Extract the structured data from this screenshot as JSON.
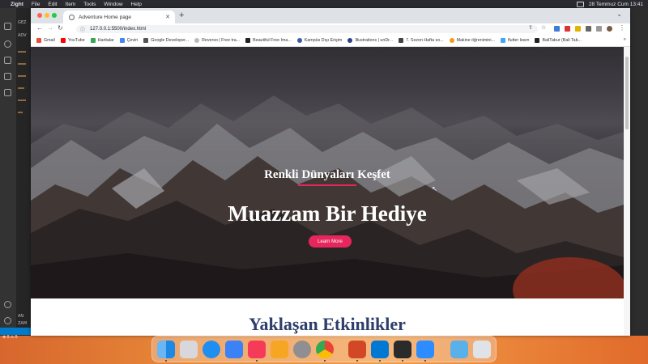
{
  "menubar": {
    "app": "Zight",
    "items": [
      "File",
      "Edit",
      "Item",
      "Tools",
      "Window",
      "Help"
    ],
    "datetime": "28 Temmuz Cum 13:41"
  },
  "browser": {
    "tab_title": "Adventure Home page",
    "url": "127.0.0.1:5500/index.html",
    "bookmarks": [
      "Gmail",
      "YouTube",
      "Haritalar",
      "Çeviri",
      "Google Developer...",
      "Reverso | Free tra...",
      "Beautiful Free Ima...",
      "Kampüs Dışı Erişim",
      "Illustrations | unDr...",
      "7. Sezon Hafta so...",
      "Makine öğrenimini...",
      "flutter learn",
      "BaliTabur (Bali Tab..."
    ]
  },
  "hero": {
    "subtitle": "Renkli Dünyaları Keşfet",
    "title": "Muazzam Bir Hediye",
    "button": "Learn More"
  },
  "section": {
    "title": "Yaklaşan Etkinlikler"
  },
  "vscode": {
    "labels": [
      "GEZ",
      "ADV",
      "AN",
      "ZAM"
    ],
    "status": "⊗ 0 ⚠ 0"
  },
  "colors": {
    "accent": "#e8265e",
    "section_title": "#2d3e6b"
  },
  "icons": [
    "apple-icon",
    "back-icon",
    "forward-icon",
    "reload-icon",
    "lock-icon",
    "share-icon",
    "star-icon",
    "extension-icon",
    "profile-icon",
    "finder-icon",
    "launchpad-icon",
    "safari-icon",
    "mail-icon",
    "music-icon",
    "pages-icon",
    "settings-icon",
    "chrome-icon",
    "powerpoint-icon",
    "vscode-icon",
    "zight-icon",
    "zoom-icon",
    "folder-icon",
    "trash-icon"
  ]
}
